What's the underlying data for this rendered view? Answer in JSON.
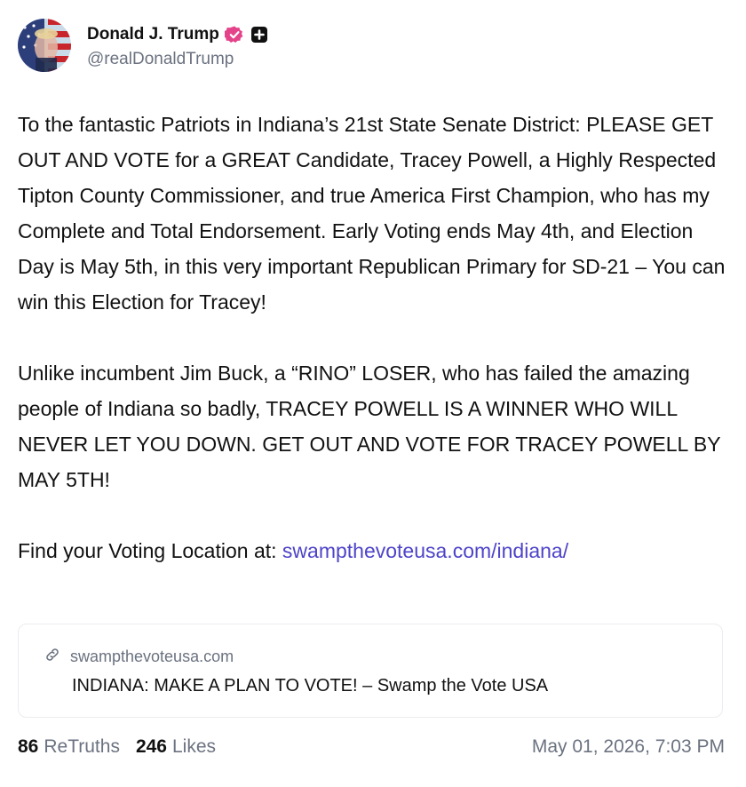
{
  "author": {
    "display_name": "Donald J. Trump",
    "handle": "@realDonaldTrump",
    "avatar_icon": "flag-portrait-avatar",
    "verified_icon": "verified-badge-icon",
    "verified_color": "#e4438a",
    "extra_icon": "plus-square-icon"
  },
  "post": {
    "paragraph_1": "To the fantastic Patriots in Indiana’s 21st State Senate District: PLEASE GET OUT AND VOTE for a GREAT Candidate, Tracey Powell, a Highly Respected Tipton County Commissioner, and true America First Champion, who has my Complete and Total Endorsement. Early Voting ends May 4th, and Election Day is May 5th, in this very important Republican Primary for SD-21 – You can win this Election for Tracey!",
    "paragraph_2": "Unlike incumbent Jim Buck, a “RINO” LOSER, who has failed the amazing people of Indiana so badly, TRACEY POWELL IS A WINNER WHO WILL NEVER LET YOU DOWN. GET OUT AND VOTE FOR TRACEY POWELL BY MAY 5TH!",
    "paragraph_3_prefix": "Find your Voting Location at: ",
    "paragraph_3_link": "swampthevoteusa.com/indiana/",
    "link_color": "#4e44c9"
  },
  "link_card": {
    "domain": "swampthevoteusa.com",
    "title": "INDIANA: MAKE A PLAN TO VOTE! – Swamp the Vote USA",
    "icon": "link-icon"
  },
  "footer": {
    "retruths_count": "86",
    "retruths_label": "ReTruths",
    "likes_count": "246",
    "likes_label": "Likes",
    "timestamp": "May 01, 2026, 7:03 PM"
  }
}
